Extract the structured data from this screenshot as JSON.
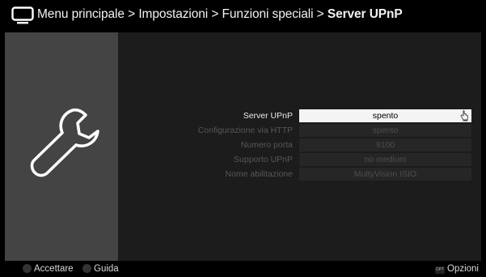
{
  "header": {
    "breadcrumb": [
      "Menu principale",
      "Impostazioni",
      "Funzioni speciali",
      "Server UPnP"
    ],
    "separator": ">"
  },
  "icons": {
    "header": "tv-icon",
    "left_panel": "wrench-icon",
    "cursor": "hand-pointer-icon"
  },
  "settings": [
    {
      "label": "Server UPnP",
      "value": "spento",
      "active": true
    },
    {
      "label": "Configurazione via HTTP",
      "value": "spento",
      "active": false
    },
    {
      "label": "Numero porta",
      "value": "9100",
      "active": false
    },
    {
      "label": "Supporto UPnP",
      "value": "no medium",
      "active": false
    },
    {
      "label": "Nome abilitazione",
      "value": "MultyVision ISIO",
      "active": false
    }
  ],
  "footer": {
    "accept_label": "Accettare",
    "guide_label": "Guida",
    "options_badge": "OPT",
    "options_label": "Opzioni"
  },
  "colors": {
    "background": "#000000",
    "left_panel": "#444444",
    "main_panel": "#1c1c1c",
    "active_value_bg": "#f4f4f4",
    "inactive_value_bg": "#262626"
  }
}
